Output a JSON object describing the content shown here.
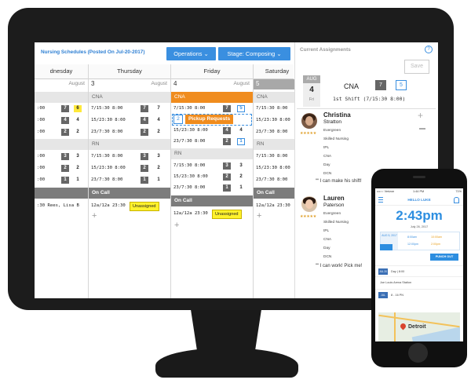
{
  "app": {
    "title": "Nursing Schedules (Posted On Jul-20-2017)",
    "operations_label": "Operations",
    "stage_label": "Stage: Composing"
  },
  "days": [
    {
      "name": "dnesday"
    },
    {
      "name": "Thursday"
    },
    {
      "name": "Friday"
    },
    {
      "name": "Saturday"
    }
  ],
  "columns": {
    "wed": {
      "month": "August",
      "cna_rows": [
        {
          "time": ":00",
          "a": "7",
          "b": "6"
        },
        {
          "time": ":00",
          "a": "4",
          "b": "4"
        },
        {
          "time": ":00",
          "a": "2",
          "b": "2"
        }
      ],
      "rn_rows": [
        {
          "time": ":00",
          "a": "3",
          "b": "3"
        },
        {
          "time": ":00",
          "a": "2",
          "b": "2"
        },
        {
          "time": ":00",
          "a": "1",
          "b": "1"
        }
      ],
      "oncall_text": ":30   Rees, Lisa B"
    },
    "thu": {
      "date": "3",
      "month": "August",
      "cna_label": "CNA",
      "cna_rows": [
        {
          "time": "7/15:30 8:00",
          "a": "7",
          "b": "7"
        },
        {
          "time": "15/23:30 8:00",
          "a": "4",
          "b": "4"
        },
        {
          "time": "23/7:30 8:00",
          "a": "2",
          "b": "2"
        }
      ],
      "rn_label": "RN",
      "rn_rows": [
        {
          "time": "7/15:30 8:00",
          "a": "3",
          "b": "3"
        },
        {
          "time": "15/23:30 8:00",
          "a": "2",
          "b": "2"
        },
        {
          "time": "23/7:30 8:00",
          "a": "1",
          "b": "1"
        }
      ],
      "oncall_label": "On Call",
      "oncall_time": "12a/12a 23:30",
      "unassigned": "Unassigned"
    },
    "fri": {
      "date": "4",
      "month": "August",
      "cna_label": "CNA",
      "cna_rows": [
        {
          "time": "7/15:30 8:00",
          "a": "7",
          "b": "5"
        },
        {
          "time": "15/23:30 8:00",
          "a": "4",
          "b": "4"
        },
        {
          "time": "23/7:30 8:00",
          "a": "2",
          "b": "1"
        }
      ],
      "pickup_num": "2",
      "pickup_label": "Pickup Requests",
      "rn_label": "RN",
      "rn_rows": [
        {
          "time": "7/15:30 8:00",
          "a": "3",
          "b": "3"
        },
        {
          "time": "15/23:30 8:00",
          "a": "2",
          "b": "2"
        },
        {
          "time": "23/7:30 8:00",
          "a": "1",
          "b": "1"
        }
      ],
      "oncall_label": "On Call",
      "oncall_time": "12a/12a 23:30",
      "unassigned": "Unassigned"
    },
    "sat": {
      "date": "5",
      "cna_label": "CNA",
      "cna_rows": [
        {
          "time": "7/15:30 8:00"
        },
        {
          "time": "15/23:30 8:00"
        },
        {
          "time": "23/7:30 8:00"
        }
      ],
      "rn_label": "RN",
      "rn_rows": [
        {
          "time": "7/15:30 8:00"
        },
        {
          "time": "15/23:30 8:00"
        },
        {
          "time": "23/7:30 8:00"
        }
      ],
      "oncall_label": "On Call",
      "oncall_time": "12a/12a 23:30"
    }
  },
  "panel": {
    "title": "Current Assignments",
    "help": "?",
    "save": "Save",
    "month": "AUG",
    "day": "4",
    "dow": "Fri",
    "position": "CNA",
    "count_a": "7",
    "count_b": "5",
    "shift": "1st Shift (7/15:30 8:00)",
    "candidates": [
      {
        "first": "Christina",
        "last": "Stratton",
        "details": [
          "Evergreen",
          "Skilled Nursing",
          "tPL",
          "CNA",
          "Day",
          "DCN"
        ],
        "quote": "I can make his shift!"
      },
      {
        "first": "Lauren",
        "last": "Paterson",
        "details": [
          "Evergreen",
          "Skilled Nursing",
          "tPL",
          "CNA",
          "Day",
          "DCN"
        ],
        "quote": "I can work! Pick me!"
      }
    ],
    "stars": "★★★★★"
  },
  "phone": {
    "carrier": "•••○○ Verizon",
    "clock": "1:44 PM",
    "battery": "71%",
    "header": "HELLO LUKE",
    "time": "2:43pm",
    "date": "July 26, 2017",
    "card_tag": "AUG 5, 2017",
    "card_time_a": "8:00am",
    "card_time_b": "12:00pm",
    "card_time_c": "10:00am",
    "card_time_d": "2:00pm",
    "punch": "PUNCH OUT",
    "item1_chip": "JUL 20",
    "item1_text": "Day  |  8:00",
    "item2_text": "Joe Louis Arena Station",
    "item3_chip": "JUL",
    "item3_text": "8 - 16  PN",
    "map_label": "Detroit"
  }
}
